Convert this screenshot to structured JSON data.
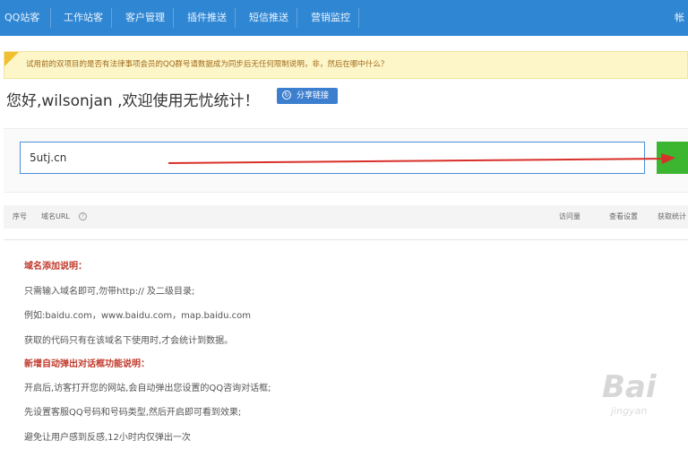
{
  "topnav": {
    "items": [
      {
        "label": "QQ站客"
      },
      {
        "label": "工作站客"
      },
      {
        "label": "客户管理"
      },
      {
        "label": "插件推送"
      },
      {
        "label": "短信推送"
      },
      {
        "label": "营销监控"
      }
    ],
    "right_label": "帐"
  },
  "notice": {
    "text": "试用前的双项目的是否有法律事项会员的QQ群号请数据成为同步后无任何限制说明，非，然后在哪中什么？"
  },
  "greeting": {
    "text": "您好,wilsonjan ,欢迎使用无忧统计！",
    "share_button": "分享链接"
  },
  "add_domain": {
    "input_value": "5utj.cn"
  },
  "toolbar": {
    "index_label": "序号",
    "domain_label": "域名URL",
    "stats_label": "访问量",
    "view_settings": "查看设置",
    "code_label": "获取统计"
  },
  "info": {
    "heading1": "域名添加说明：",
    "line1": "只需输入域名即可,勿带http:// 及二级目录;",
    "line2": "例如:baidu.com，www.baidu.com，map.baidu.com",
    "line3": "获取的代码只有在该域名下使用时,才会统计到数据。",
    "heading2": "新增自动弹出对话框功能说明：",
    "line4": "开启后,访客打开您的网站,会自动弹出您设置的QQ咨询对话框;",
    "line5": "先设置客服QQ号码和号码类型,然后开启即可看到效果;",
    "line6": "避免让用户感到反感,12小时内仅弹出一次"
  },
  "watermark": {
    "main": "Bai",
    "sub": "jingyan"
  },
  "colors": {
    "nav": "#2f86d2",
    "accent_green": "#3cb531",
    "heading_red": "#c0392b",
    "arrow_red": "#d9302a"
  }
}
